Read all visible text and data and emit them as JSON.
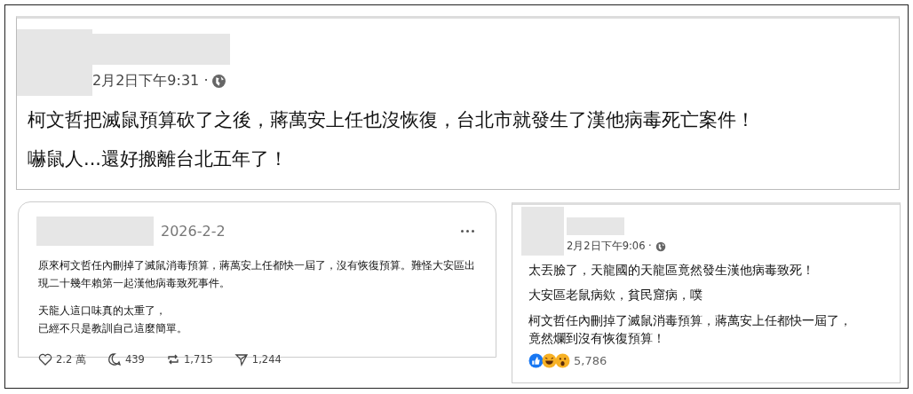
{
  "top_post": {
    "timestamp": "2月2日下午9:31 ·",
    "paragraphs": [
      "柯文哲把滅鼠預算砍了之後，蔣萬安上任也沒恢復，台北市就發生了漢他病毒死亡案件！",
      "嚇鼠人...還好搬離台北五年了！"
    ]
  },
  "threads_post": {
    "date": "2026-2-2",
    "paragraphs": [
      "原來柯文哲任內刪掉了滅鼠消毒預算，蔣萬安上任都快一屆了，沒有恢復預算。難怪大安區出現二十幾年賴第一起漢他病毒致死事件。",
      [
        "天龍人這口味真的太重了，",
        "已經不只是教訓自己這麼簡單。"
      ]
    ],
    "stats": [
      {
        "kind": "like",
        "value": "2.2 萬"
      },
      {
        "kind": "reply",
        "value": "439"
      },
      {
        "kind": "repost",
        "value": "1,715"
      },
      {
        "kind": "share",
        "value": "1,244"
      }
    ]
  },
  "facebook_post": {
    "timestamp": "2月2日下午9:06 ·",
    "paragraphs": [
      "太丟臉了，天龍國的天龍區竟然發生漢他病毒致死！",
      "大安區老鼠病欸，貧民窟病，噗",
      [
        "柯文哲任內刪掉了滅鼠消毒預算，蔣萬安上任都快一屆了，",
        "竟然爛到沒有恢復預算！"
      ]
    ],
    "reactions": [
      {
        "kind": "like"
      },
      {
        "kind": "haha"
      },
      {
        "kind": "wow"
      }
    ],
    "reaction_count": "5,786"
  }
}
